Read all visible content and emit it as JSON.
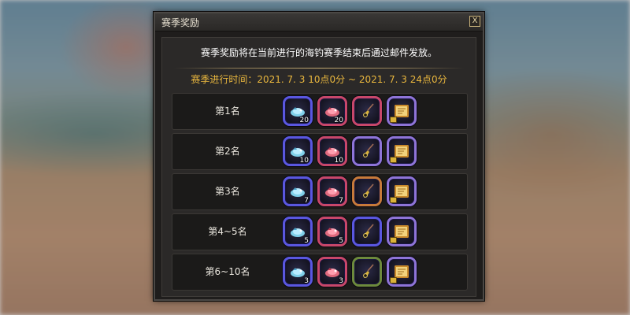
{
  "window": {
    "title": "赛季奖励",
    "close_label": "X"
  },
  "description": "赛季奖励将在当前进行的海钓赛季结束后通过邮件发放。",
  "period": "赛季进行时间：2021. 7. 3 10点0分 ~ 2021. 7. 3 24点0分",
  "colors": {
    "period_text": "#e8b63e",
    "slot_blue": "#5a57e0",
    "slot_pink": "#c8476a",
    "slot_orange": "#c77a3a",
    "slot_green": "#6d8a3c",
    "slot_purple": "#8e74d8"
  },
  "rows": [
    {
      "rank": "第1名",
      "items": [
        {
          "icon": "blue-lure-icon",
          "grade": "blue",
          "qty": "20"
        },
        {
          "icon": "red-lure-icon",
          "grade": "pink",
          "qty": "20"
        },
        {
          "icon": "amulet-icon",
          "grade": "pink",
          "qty": ""
        },
        {
          "icon": "scroll-box-icon",
          "grade": "purple",
          "qty": ""
        }
      ]
    },
    {
      "rank": "第2名",
      "items": [
        {
          "icon": "blue-lure-icon",
          "grade": "blue",
          "qty": "10"
        },
        {
          "icon": "red-lure-icon",
          "grade": "pink",
          "qty": "10"
        },
        {
          "icon": "amulet-icon",
          "grade": "purple",
          "qty": ""
        },
        {
          "icon": "scroll-box-icon",
          "grade": "purple",
          "qty": ""
        }
      ]
    },
    {
      "rank": "第3名",
      "items": [
        {
          "icon": "blue-lure-icon",
          "grade": "blue",
          "qty": "7"
        },
        {
          "icon": "red-lure-icon",
          "grade": "pink",
          "qty": "7"
        },
        {
          "icon": "amulet-icon",
          "grade": "orange",
          "qty": ""
        },
        {
          "icon": "scroll-box-icon",
          "grade": "purple",
          "qty": ""
        }
      ]
    },
    {
      "rank": "第4~5名",
      "items": [
        {
          "icon": "blue-lure-icon",
          "grade": "blue",
          "qty": "5"
        },
        {
          "icon": "red-lure-icon",
          "grade": "pink",
          "qty": "5"
        },
        {
          "icon": "amulet-icon",
          "grade": "blue",
          "qty": ""
        },
        {
          "icon": "scroll-box-icon",
          "grade": "purple",
          "qty": ""
        }
      ]
    },
    {
      "rank": "第6~10名",
      "items": [
        {
          "icon": "blue-lure-icon",
          "grade": "blue",
          "qty": "3"
        },
        {
          "icon": "red-lure-icon",
          "grade": "pink",
          "qty": "3"
        },
        {
          "icon": "amulet-icon",
          "grade": "green",
          "qty": ""
        },
        {
          "icon": "scroll-box-icon",
          "grade": "purple",
          "qty": ""
        }
      ]
    }
  ]
}
